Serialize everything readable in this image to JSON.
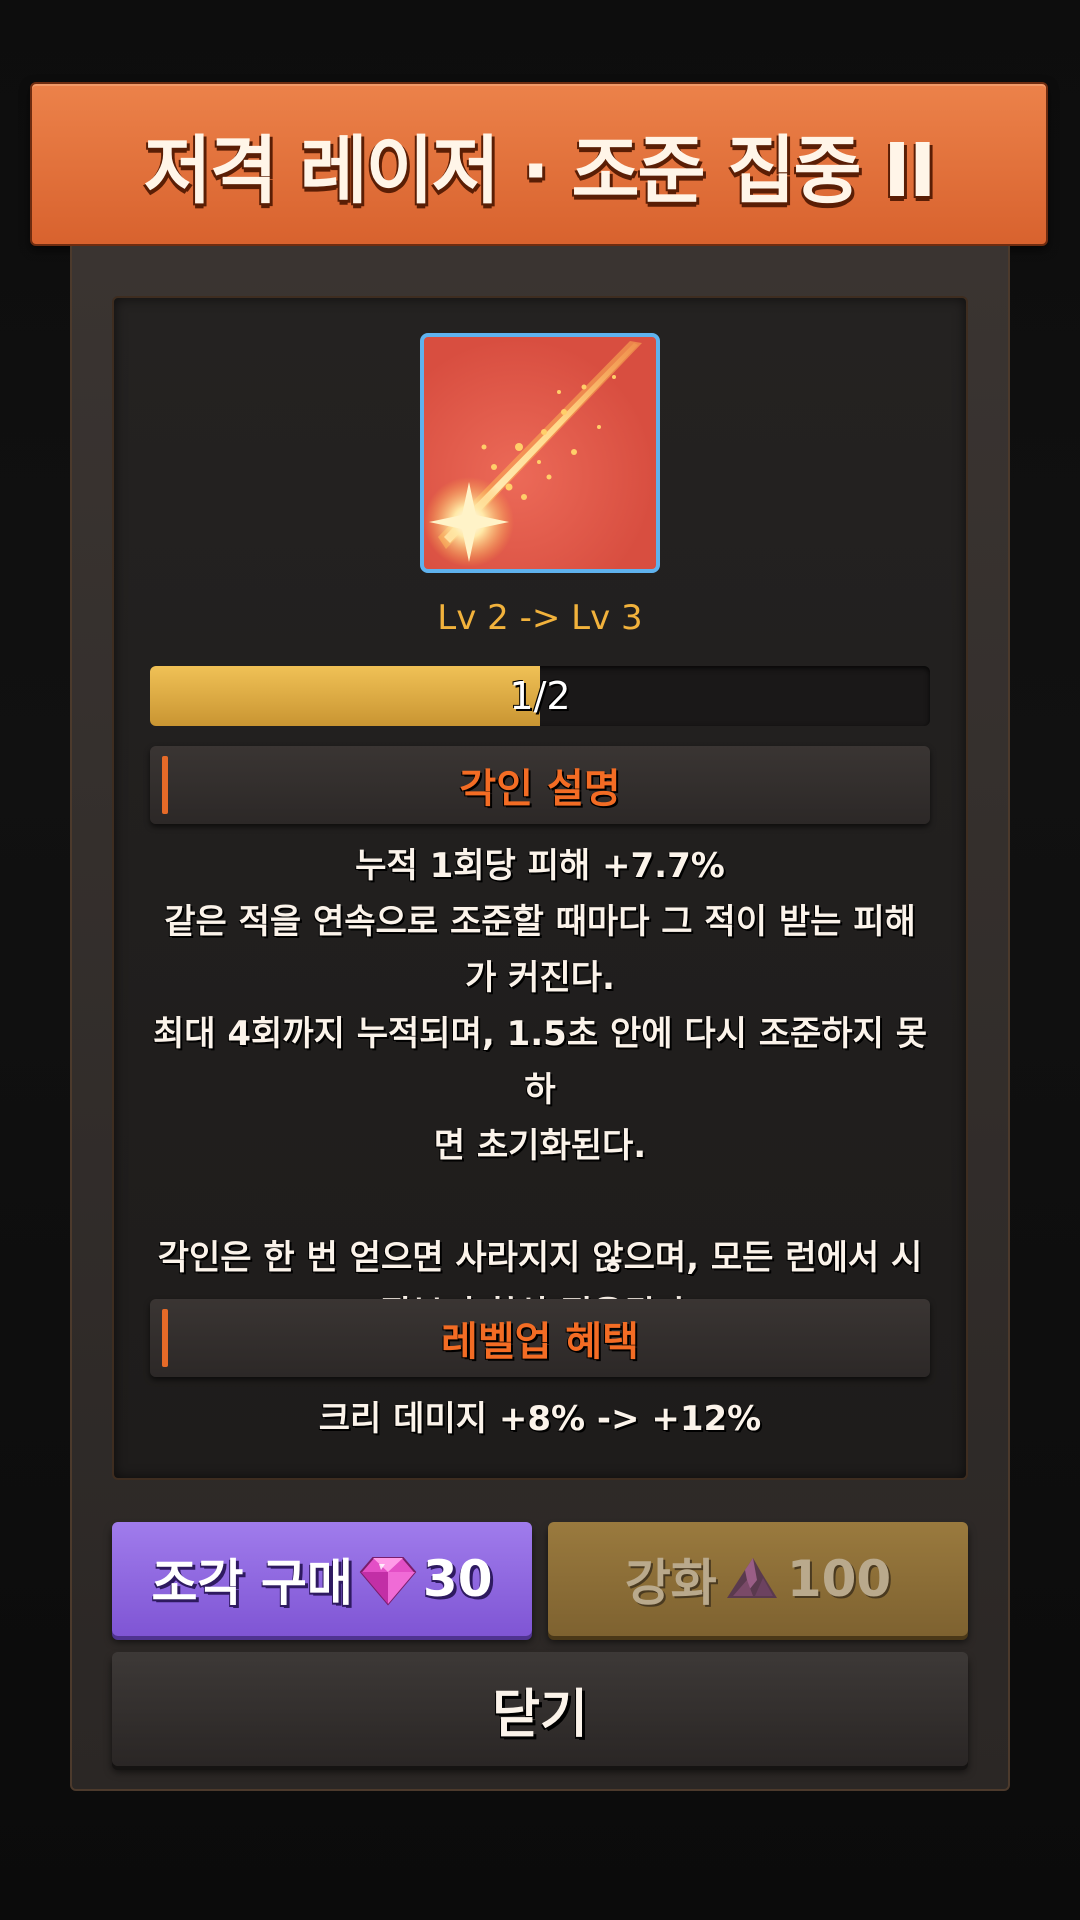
{
  "header": {
    "title": "저격 레이저 · 조준 집중 II"
  },
  "engraving": {
    "icon": "laser-streak-icon",
    "level_text": "Lv 2 -> Lv 3",
    "progress_text": "1/2",
    "progress_fraction": 0.5
  },
  "description_section": {
    "title": "각인 설명",
    "lines": [
      "누적 1회당 피해 +7.7%",
      "같은 적을 연속으로 조준할 때마다 그 적이 받는 피해",
      "가 커진다.",
      "최대 4회까지 누적되며, 1.5초 안에 다시 조준하지 못하",
      "면 초기화된다.",
      "",
      "각인은 한 번 얻으면 사라지지 않으며, 모든 런에서 시",
      "작부터 항상 적용된다."
    ]
  },
  "levelup_section": {
    "title": "레벨업 혜택",
    "benefit": "크리 데미지  +8% -> +12%"
  },
  "buttons": {
    "buy_label": "조각 구매",
    "buy_cost": "30",
    "buy_icon": "gem-icon",
    "upgrade_label": "강화",
    "upgrade_cost": "100",
    "upgrade_icon": "shard-pile-icon",
    "close_label": "닫기"
  },
  "colors": {
    "header": "#e2703a",
    "accent": "#f36c24",
    "level_text": "#f2b23c",
    "progress_fill": "#e0ad45",
    "icon_border": "#5fb2ee",
    "buy_button": "#8e68e0",
    "upgrade_button": "#8c6f36"
  }
}
